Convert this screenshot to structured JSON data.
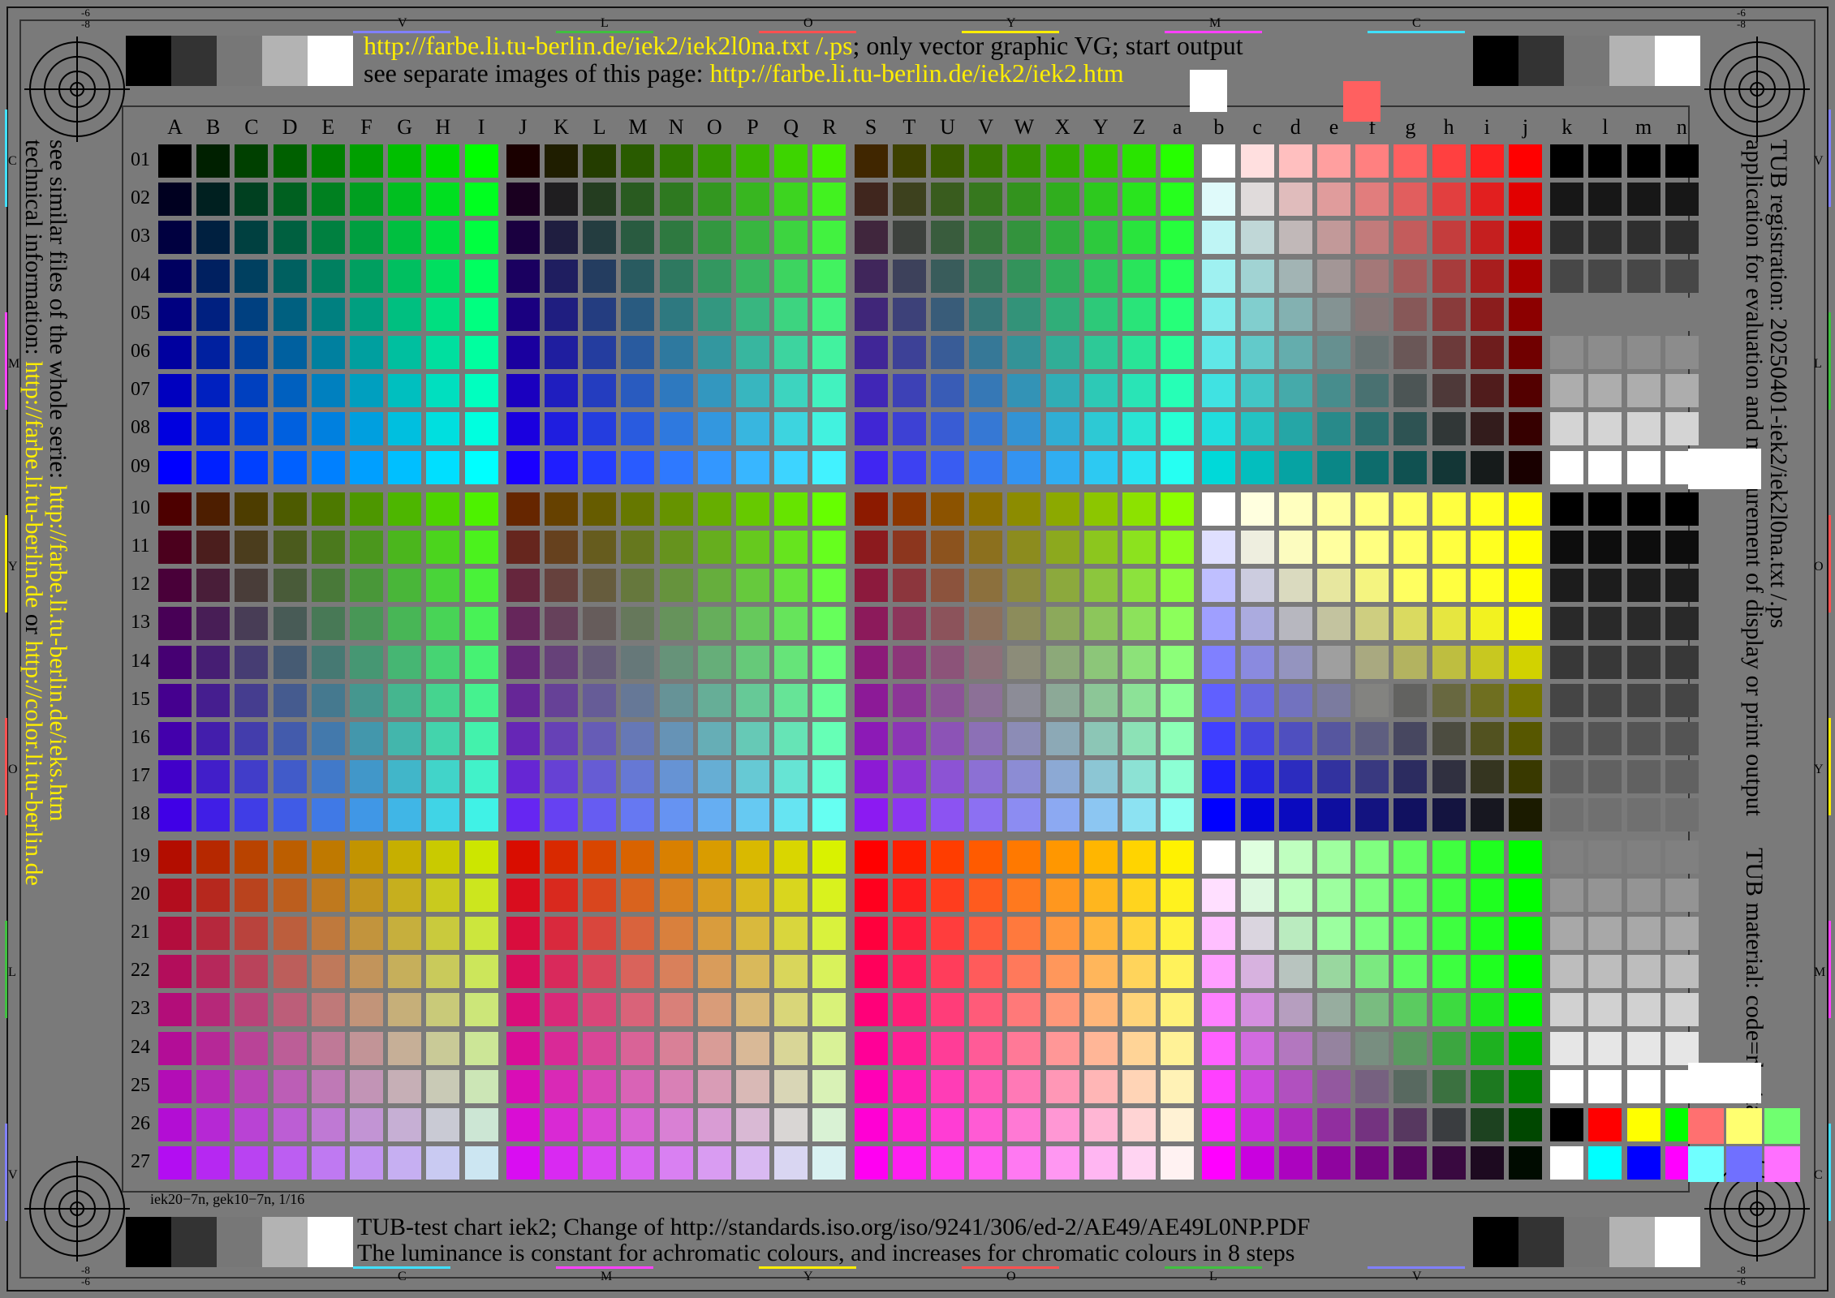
{
  "header": {
    "line1_url": "http://farbe.li.tu-berlin.de/iek2/iek2l0na.txt /.ps",
    "line1_rest": "; only vector graphic VG; start output",
    "line2_prefix": "see separate images of this page: ",
    "line2_url": "http://farbe.li.tu-berlin.de/iek2/iek2.htm"
  },
  "footer": {
    "line1": "TUB-test chart iek2; Change of http://standards.iso.org/iso/9241/306/ed-2/AE49/AE49L0NP.PDF",
    "line2": "The luminance is constant for achromatic colours,  and increases for chromatic colours in 8 steps",
    "small_note": "iek20−7n, gek10−7n, 1/16"
  },
  "left_side": {
    "line1_prefix": "see similar files of the whole serie: ",
    "line1_url": "http://farbe.li.tu-berlin.de/ieks.htm",
    "line2_prefix": "technical information: ",
    "line2_url1": "http://farbe.li.tu-berlin.de",
    "line2_or": " or ",
    "line2_url2": "http://color.li.tu-berlin.de"
  },
  "right_side": {
    "line1": "TUB registration: 20250401-iek2/iek2l0na.txt /.ps",
    "line2a": "application for evaluation and measurement of display or print output",
    "line2b": "TUB material: code=rha4ta"
  },
  "edge_marks": {
    "top": [
      "V",
      "L",
      "O",
      "Y",
      "M",
      "C"
    ],
    "bottom": [
      "C",
      "M",
      "Y",
      "O",
      "L",
      "V"
    ],
    "left": [
      "C",
      "M",
      "Y",
      "O",
      "L",
      "V"
    ],
    "right": [
      "V",
      "L",
      "O",
      "Y",
      "M",
      "C"
    ],
    "corner_top": [
      "-6",
      "-8"
    ],
    "corner_bottom": [
      "-8",
      "-6"
    ]
  },
  "grid": {
    "column_labels": [
      "A",
      "B",
      "C",
      "D",
      "E",
      "F",
      "G",
      "H",
      "I",
      "J",
      "K",
      "L",
      "M",
      "N",
      "O",
      "P",
      "Q",
      "R",
      "S",
      "T",
      "U",
      "V",
      "W",
      "X",
      "Y",
      "Z",
      "a",
      "b",
      "c",
      "d",
      "e",
      "f",
      "g",
      "h",
      "i",
      "j",
      "k",
      "l",
      "m",
      "n"
    ],
    "row_labels": [
      "01",
      "02",
      "03",
      "04",
      "05",
      "06",
      "07",
      "08",
      "09",
      "10",
      "11",
      "12",
      "13",
      "14",
      "15",
      "16",
      "17",
      "18",
      "19",
      "20",
      "21",
      "22",
      "23",
      "24",
      "25",
      "26",
      "27"
    ]
  },
  "colors": {
    "background": "#7a7a7a",
    "link_yellow": "#ffee00",
    "gray_steps": [
      "#000000",
      "#333333",
      "#777777",
      "#b3b3b3",
      "#ffffff"
    ]
  }
}
